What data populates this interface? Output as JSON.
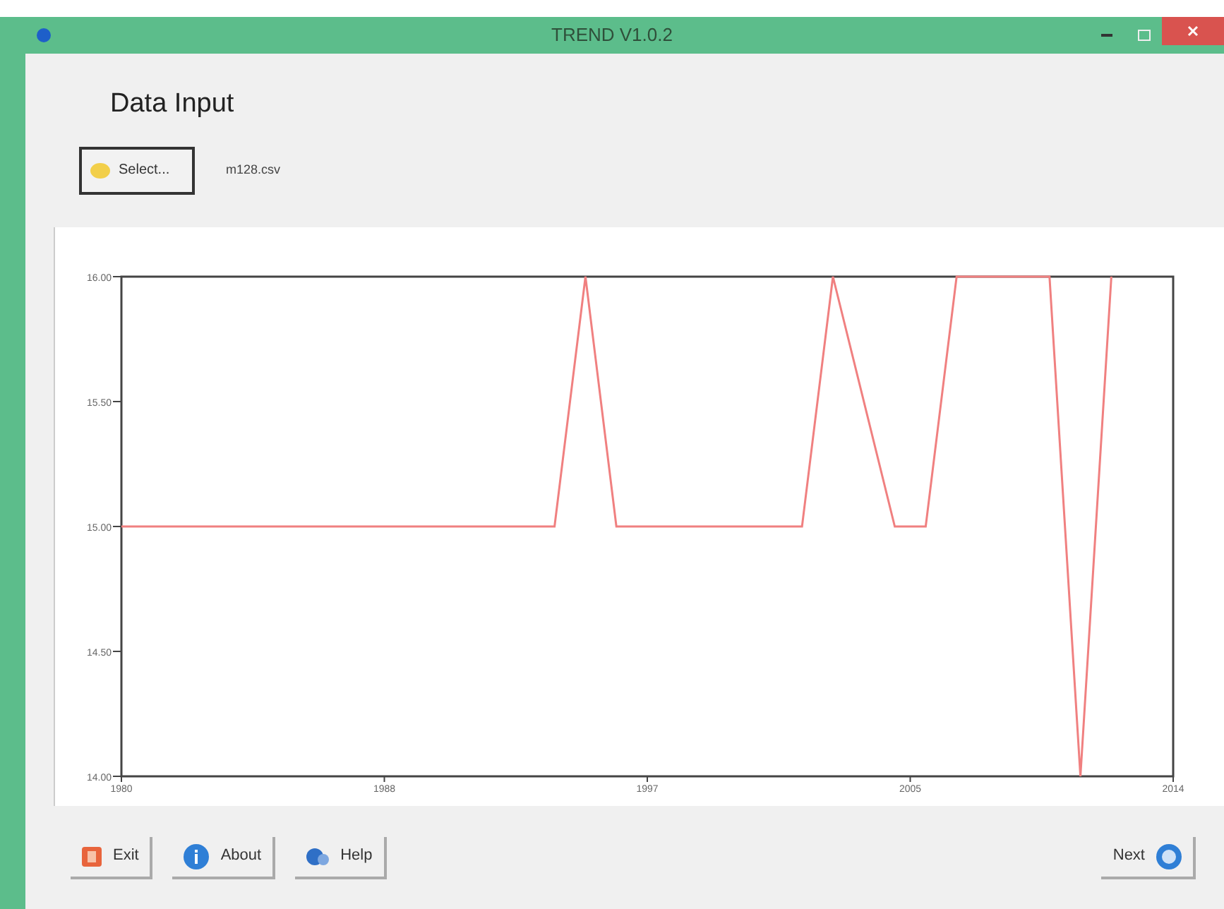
{
  "window": {
    "title": "TREND V1.0.2"
  },
  "heading": "Data Input",
  "select_button": {
    "label": "Select..."
  },
  "file_name": "m128.csv",
  "chart": {
    "chart_data": {
      "type": "line",
      "x": [
        1980,
        1994,
        1995,
        1996,
        2002,
        2003,
        2005,
        2006,
        2007,
        2010,
        2011,
        2012
      ],
      "series": [
        {
          "color": "#f08080",
          "values": [
            15,
            15,
            16,
            15,
            15,
            16,
            15,
            15,
            16,
            16,
            14,
            16
          ]
        }
      ],
      "xlim": [
        1980,
        2014
      ],
      "ylim": [
        14,
        16
      ],
      "xticks": [
        {
          "value": 1980,
          "label": "1980"
        },
        {
          "value": 1988.5,
          "label": "1988"
        },
        {
          "value": 1997,
          "label": "1997"
        },
        {
          "value": 2005.5,
          "label": "2005"
        },
        {
          "value": 2014,
          "label": "2014"
        }
      ],
      "yticks": [
        {
          "value": 14,
          "label": "14.00"
        },
        {
          "value": 14.5,
          "label": "14.50"
        },
        {
          "value": 15,
          "label": "15.00"
        },
        {
          "value": 15.5,
          "label": "15.50"
        },
        {
          "value": 16,
          "label": "16.00"
        }
      ]
    }
  },
  "buttons": [
    {
      "kind": "exit",
      "label": "Exit"
    },
    {
      "kind": "about",
      "label": "About"
    },
    {
      "kind": "help",
      "label": "Help"
    },
    {
      "kind": "next",
      "label": "Next"
    }
  ]
}
